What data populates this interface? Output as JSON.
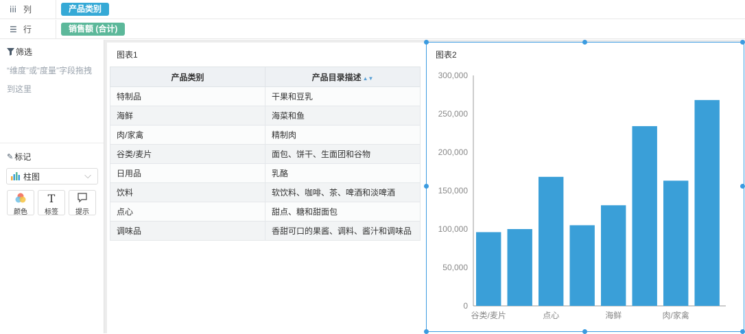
{
  "shelves": {
    "columns": {
      "label": "列",
      "icon": "columns-icon",
      "field": "产品类别",
      "color": "#35a9d6"
    },
    "rows": {
      "label": "行",
      "icon": "rows-icon",
      "field": "销售额 (合计)",
      "color": "#5cb89a"
    }
  },
  "filter": {
    "title": "筛选",
    "hint": "“维度”或“度量”字段拖拽到这里"
  },
  "marks": {
    "title": "标记",
    "type": "柱图",
    "buttons": [
      {
        "label": "颜色",
        "icon": "color-icon"
      },
      {
        "label": "标签",
        "icon": "text-icon"
      },
      {
        "label": "提示",
        "icon": "tooltip-icon"
      }
    ]
  },
  "chart1": {
    "title": "图表1",
    "columns": [
      "产品类别",
      "产品目录描述"
    ],
    "rows": [
      [
        "特制品",
        "干果和豆乳"
      ],
      [
        "海鲜",
        "海菜和鱼"
      ],
      [
        "肉/家禽",
        "精制肉"
      ],
      [
        "谷类/麦片",
        "面包、饼干、生面团和谷物"
      ],
      [
        "日用品",
        "乳酪"
      ],
      [
        "饮料",
        "软饮料、咖啡、茶、啤酒和淡啤酒"
      ],
      [
        "点心",
        "甜点、糖和甜面包"
      ],
      [
        "调味品",
        "香甜可口的果酱、调料、酱汁和调味品"
      ]
    ]
  },
  "chart2": {
    "title": "图表2"
  },
  "chart_data": {
    "type": "bar",
    "categories": [
      "谷类/麦片",
      "",
      "点心",
      "",
      "",
      "海鲜",
      "",
      "肉/家禽",
      ""
    ],
    "values": [
      96000,
      100000,
      168000,
      105000,
      131000,
      234000,
      163000,
      268000
    ],
    "ylim": [
      0,
      300000
    ],
    "yticks": [
      "0",
      "50,000",
      "100,000",
      "150,000",
      "200,000",
      "250,000",
      "300,000"
    ],
    "xtick_labels": [
      "谷类/麦片",
      "点心",
      "海鲜",
      "肉/家禽"
    ],
    "bar_color": "#3a9fd8",
    "grid": false
  }
}
